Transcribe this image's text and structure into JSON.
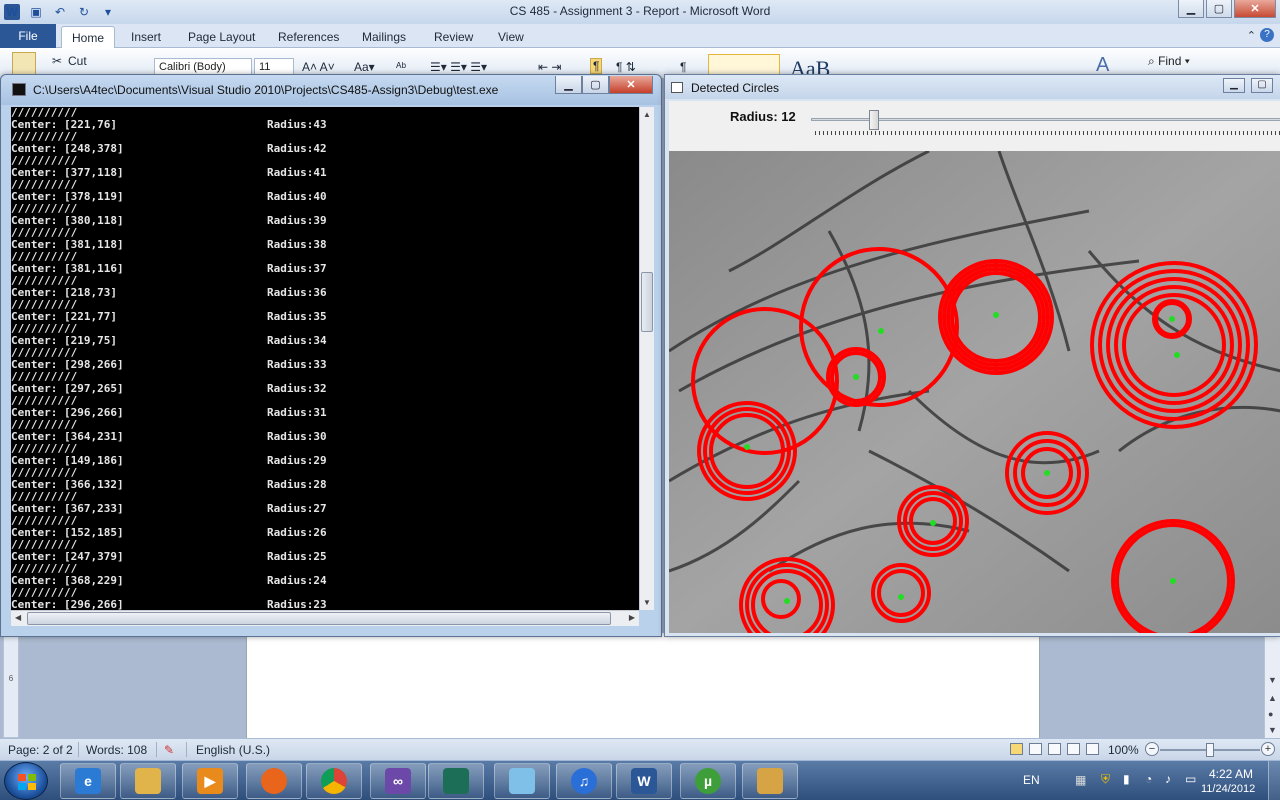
{
  "word": {
    "title": "CS 485 - Assignment 3 - Report  -  Microsoft Word",
    "tabs": [
      "File",
      "Home",
      "Insert",
      "Page Layout",
      "References",
      "Mailings",
      "Review",
      "View"
    ],
    "active_tab": "Home",
    "clipboard_cut": "Cut",
    "font_name": "Calibri (Body)",
    "font_size": "11",
    "find_label": "Find",
    "ruler_mark": "6"
  },
  "statusbar": {
    "page": "Page: 2 of 2",
    "words": "Words: 108",
    "language": "English (U.S.)",
    "zoom": "100%",
    "zoom_percent": 100
  },
  "console": {
    "title": "C:\\Users\\A4tec\\Documents\\Visual Studio 2010\\Projects\\CS485-Assign3\\Debug\\test.exe",
    "separator": "//////////",
    "entries": [
      {
        "center": "Center: [221,76]",
        "radius": "Radius:43"
      },
      {
        "center": "Center: [248,378]",
        "radius": "Radius:42"
      },
      {
        "center": "Center: [377,118]",
        "radius": "Radius:41"
      },
      {
        "center": "Center: [378,119]",
        "radius": "Radius:40"
      },
      {
        "center": "Center: [380,118]",
        "radius": "Radius:39"
      },
      {
        "center": "Center: [381,118]",
        "radius": "Radius:38"
      },
      {
        "center": "Center: [381,116]",
        "radius": "Radius:37"
      },
      {
        "center": "Center: [218,73]",
        "radius": "Radius:36"
      },
      {
        "center": "Center: [221,77]",
        "radius": "Radius:35"
      },
      {
        "center": "Center: [219,75]",
        "radius": "Radius:34"
      },
      {
        "center": "Center: [298,266]",
        "radius": "Radius:33"
      },
      {
        "center": "Center: [297,265]",
        "radius": "Radius:32"
      },
      {
        "center": "Center: [296,266]",
        "radius": "Radius:31"
      },
      {
        "center": "Center: [364,231]",
        "radius": "Radius:30"
      },
      {
        "center": "Center: [149,186]",
        "radius": "Radius:29"
      },
      {
        "center": "Center: [366,132]",
        "radius": "Radius:28"
      },
      {
        "center": "Center: [367,233]",
        "radius": "Radius:27"
      },
      {
        "center": "Center: [152,185]",
        "radius": "Radius:26"
      },
      {
        "center": "Center: [247,379]",
        "radius": "Radius:25"
      },
      {
        "center": "Center: [368,229]",
        "radius": "Radius:24"
      },
      {
        "center": "Center: [296,266]",
        "radius": "Radius:23"
      }
    ]
  },
  "detected": {
    "title": "Detected Circles",
    "radius_label": "Radius: 12",
    "radius_value": 12,
    "circle_color": "#ff0000",
    "center_color": "#22dd22"
  },
  "taskbar": {
    "apps": [
      "windows-explorer",
      "internet-explorer",
      "media-player",
      "firefox",
      "chrome",
      "visual-studio",
      "console-app",
      "notepad",
      "itunes",
      "word",
      "utorrent",
      "paint"
    ],
    "language": "EN",
    "time": "4:22 AM",
    "date": "11/24/2012"
  }
}
